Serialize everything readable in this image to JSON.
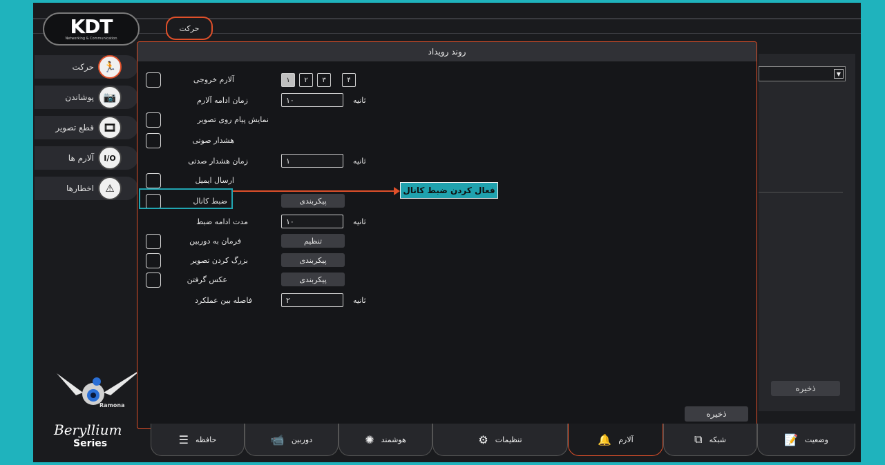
{
  "breadcrumb": "حرکت",
  "logo": {
    "mark": "KDT",
    "sub": "Networking & Communication"
  },
  "sidebar": {
    "items": [
      {
        "label": "حرکت",
        "icon": "running-person-icon"
      },
      {
        "label": "پوشاندن",
        "icon": "camera-cover-icon"
      },
      {
        "label": "قطع تصویر",
        "icon": "video-loss-icon"
      },
      {
        "label": "آلارم ها",
        "icon": "io-icon"
      },
      {
        "label": "اخطارها",
        "icon": "warning-icon"
      }
    ]
  },
  "brand": {
    "ramona": "Ramona",
    "beryllium": "Beryllium",
    "series": "Series"
  },
  "right_panel": {
    "save": "ذخیره"
  },
  "dialog": {
    "title": "روند رویداد",
    "alarm_out_label": "آلارم خروجی",
    "channels": [
      "۱",
      "۲",
      "۳",
      "۴"
    ],
    "alarm_duration_label": "زمان ادامه آلارم",
    "alarm_duration_value": "۱۰",
    "show_message_label": "نمایش پیام روی تصویر",
    "audio_warning_label": "هشدار صوتی",
    "audio_time_label": "زمان هشدار صدتی",
    "audio_time_value": "۱",
    "send_email_label": "ارسال ایمیل",
    "record_channel_label": "ضبط کانال",
    "record_duration_label": "مدت ادامه ضبط",
    "record_duration_value": "۱۰",
    "ptz_label": "فرمان به دوربین",
    "enlarge_label": "بزرگ کردن تصویر",
    "snapshot_label": "عکس گرفتن",
    "interval_label": "فاصله بین عملکرد",
    "interval_value": "۲",
    "unit": "ثانیه",
    "config_btn": "پیکربندی",
    "setup_btn": "تنظیم",
    "save": "ذخیره"
  },
  "callout": "فعال کردن ضبط کانال",
  "bottom_tabs": [
    {
      "label": "حافظه",
      "icon": "storage-icon"
    },
    {
      "label": "دوربین",
      "icon": "camera-icon"
    },
    {
      "label": "هوشمند",
      "icon": "intelligent-icon"
    },
    {
      "label": "تنظیمات",
      "icon": "gears-icon"
    },
    {
      "label": "آلارم",
      "icon": "alarm-bell-icon"
    },
    {
      "label": "شبکه",
      "icon": "network-icon"
    },
    {
      "label": "وضعیت",
      "icon": "status-icon"
    }
  ],
  "accent_color": "#e0502a",
  "highlight_color": "#21a6b2"
}
